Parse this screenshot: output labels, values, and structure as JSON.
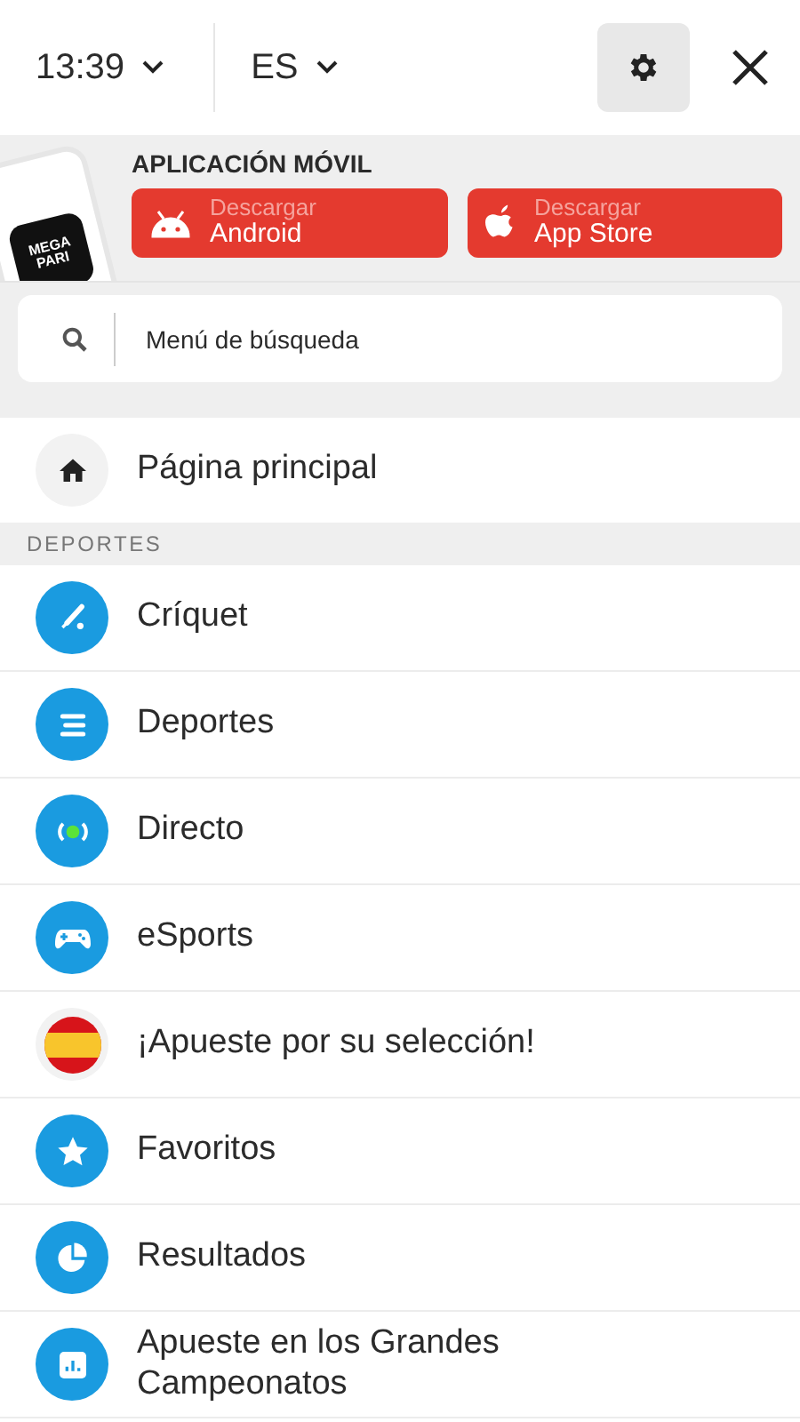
{
  "header": {
    "time": "13:39",
    "language": "ES"
  },
  "app_banner": {
    "title": "APLICACIÓN MÓVIL",
    "logo_text": "MEGA PARI",
    "buttons": [
      {
        "kind": "android",
        "caption": "Descargar",
        "label": "Android"
      },
      {
        "kind": "apple",
        "caption": "Descargar",
        "label": "App Store"
      }
    ]
  },
  "search": {
    "placeholder": "Menú de búsqueda"
  },
  "home": {
    "label": "Página principal"
  },
  "section": {
    "title": "DEPORTES"
  },
  "items": [
    {
      "kind": "cricket",
      "label": "Críquet"
    },
    {
      "kind": "list",
      "label": "Deportes"
    },
    {
      "kind": "live",
      "label": "Directo"
    },
    {
      "kind": "gamepad",
      "label": "eSports"
    },
    {
      "kind": "flag",
      "label": "¡Apueste por su selección!"
    },
    {
      "kind": "star",
      "label": "Favoritos"
    },
    {
      "kind": "pie",
      "label": "Resultados"
    },
    {
      "kind": "chart",
      "label": "Apueste en los Grandes Campeonatos"
    }
  ]
}
